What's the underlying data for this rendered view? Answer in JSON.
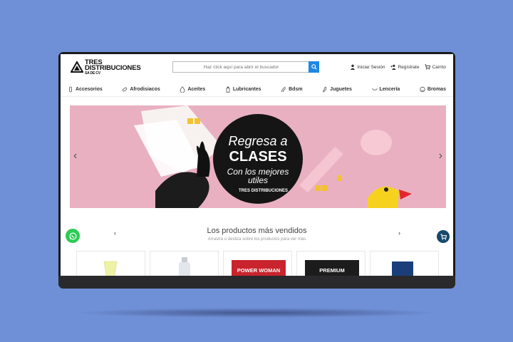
{
  "brand": {
    "line1": "TRES",
    "line2": "DISTRIBUCIONES",
    "line3": "SA DE CV"
  },
  "search": {
    "placeholder": "Haz click aquí para abrir el buscador",
    "icon": "search-icon"
  },
  "header_links": [
    {
      "label": "Iniciar Sesión",
      "icon": "user-icon"
    },
    {
      "label": "Regístrate",
      "icon": "user-plus-icon"
    },
    {
      "label": "Carrito",
      "icon": "cart-icon"
    }
  ],
  "categories": [
    {
      "label": "Accesorios",
      "icon": "accessory-icon"
    },
    {
      "label": "Afrodisiacos",
      "icon": "pill-icon"
    },
    {
      "label": "Aceites",
      "icon": "drop-icon"
    },
    {
      "label": "Lubricantes",
      "icon": "bottle-icon"
    },
    {
      "label": "Bdsm",
      "icon": "whip-icon"
    },
    {
      "label": "Juguetes",
      "icon": "toy-icon"
    },
    {
      "label": "Lencería",
      "icon": "lingerie-icon"
    },
    {
      "label": "Bromas",
      "icon": "smile-icon"
    }
  ],
  "banner": {
    "line1": "Regresa a",
    "line2": "CLASES",
    "line3": "Con los mejores",
    "line4": "utiles",
    "brand": "TRES DISTRIBUCIONES",
    "background": "#e9b0c2"
  },
  "products": {
    "title": "Los productos más vendidos",
    "subtitle": "Arrastra o desliza sobre los productos para ver más",
    "tags": [
      "",
      "",
      "POWER WOMAN",
      "PREMIUM",
      ""
    ]
  },
  "colors": {
    "accent": "#1e88e5",
    "whatsapp": "#2ecc55",
    "cart": "#17496b"
  }
}
